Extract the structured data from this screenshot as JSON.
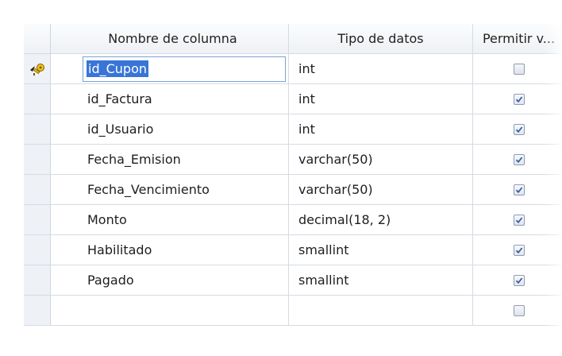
{
  "columns": {
    "name": "Nombre de columna",
    "type": "Tipo de datos",
    "allow_null": "Permitir v..."
  },
  "rows": [
    {
      "name": "id_Cupon",
      "type": "int",
      "allow_null": false,
      "primary_key": true,
      "selected": true
    },
    {
      "name": "id_Factura",
      "type": "int",
      "allow_null": true
    },
    {
      "name": "id_Usuario",
      "type": "int",
      "allow_null": true
    },
    {
      "name": "Fecha_Emision",
      "type": "varchar(50)",
      "allow_null": true
    },
    {
      "name": "Fecha_Vencimiento",
      "type": "varchar(50)",
      "allow_null": true
    },
    {
      "name": "Monto",
      "type": "decimal(18, 2)",
      "allow_null": true
    },
    {
      "name": "Habilitado",
      "type": "smallint",
      "allow_null": true
    },
    {
      "name": "Pagado",
      "type": "smallint",
      "allow_null": true
    },
    {
      "name": "",
      "type": "",
      "allow_null": false
    }
  ],
  "colors": {
    "selection": "#3875d7",
    "check": "#3a5f9a",
    "grid_line": "#d6dbe3"
  }
}
